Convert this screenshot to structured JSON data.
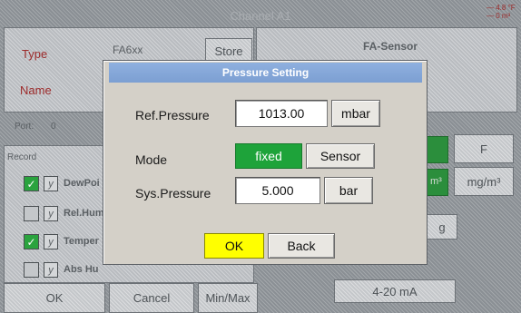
{
  "window": {
    "title": "Channel A1",
    "corner_lines": [
      "— 4.8 °F",
      "— 0 m³"
    ]
  },
  "background": {
    "type_label": "Type",
    "type_value": "FA6xx",
    "store_button": "Store",
    "name_label": "Name",
    "sensor_header": "FA-Sensor",
    "port_label": "Port:",
    "port_value": "0",
    "record_label": "Record",
    "records": [
      {
        "label": "DewPoi",
        "checked": true
      },
      {
        "label": "Rel.Hum",
        "checked": false
      },
      {
        "label": "Temper",
        "checked": true
      },
      {
        "label": "Abs Hu",
        "checked": false
      }
    ],
    "unit_f": "F",
    "unit_mgm3": "mg/m³",
    "unit_m3": "m³",
    "unit_g": "g",
    "output_label": "4-20 mA",
    "bottom_buttons": [
      "OK",
      "Cancel",
      "Min/Max"
    ]
  },
  "dialog": {
    "title": "Pressure Setting",
    "ref_pressure_label": "Ref.Pressure",
    "ref_pressure_value": "1013.00",
    "ref_pressure_unit": "mbar",
    "mode_label": "Mode",
    "mode_fixed": "fixed",
    "mode_sensor": "Sensor",
    "mode_selected": "fixed",
    "sys_pressure_label": "Sys.Pressure",
    "sys_pressure_value": "5.000",
    "sys_pressure_unit": "bar",
    "ok_label": "OK",
    "back_label": "Back"
  },
  "colors": {
    "accent_green": "#1ea33a",
    "ok_yellow": "#ffff00",
    "title_blue": "#8fb0df"
  }
}
